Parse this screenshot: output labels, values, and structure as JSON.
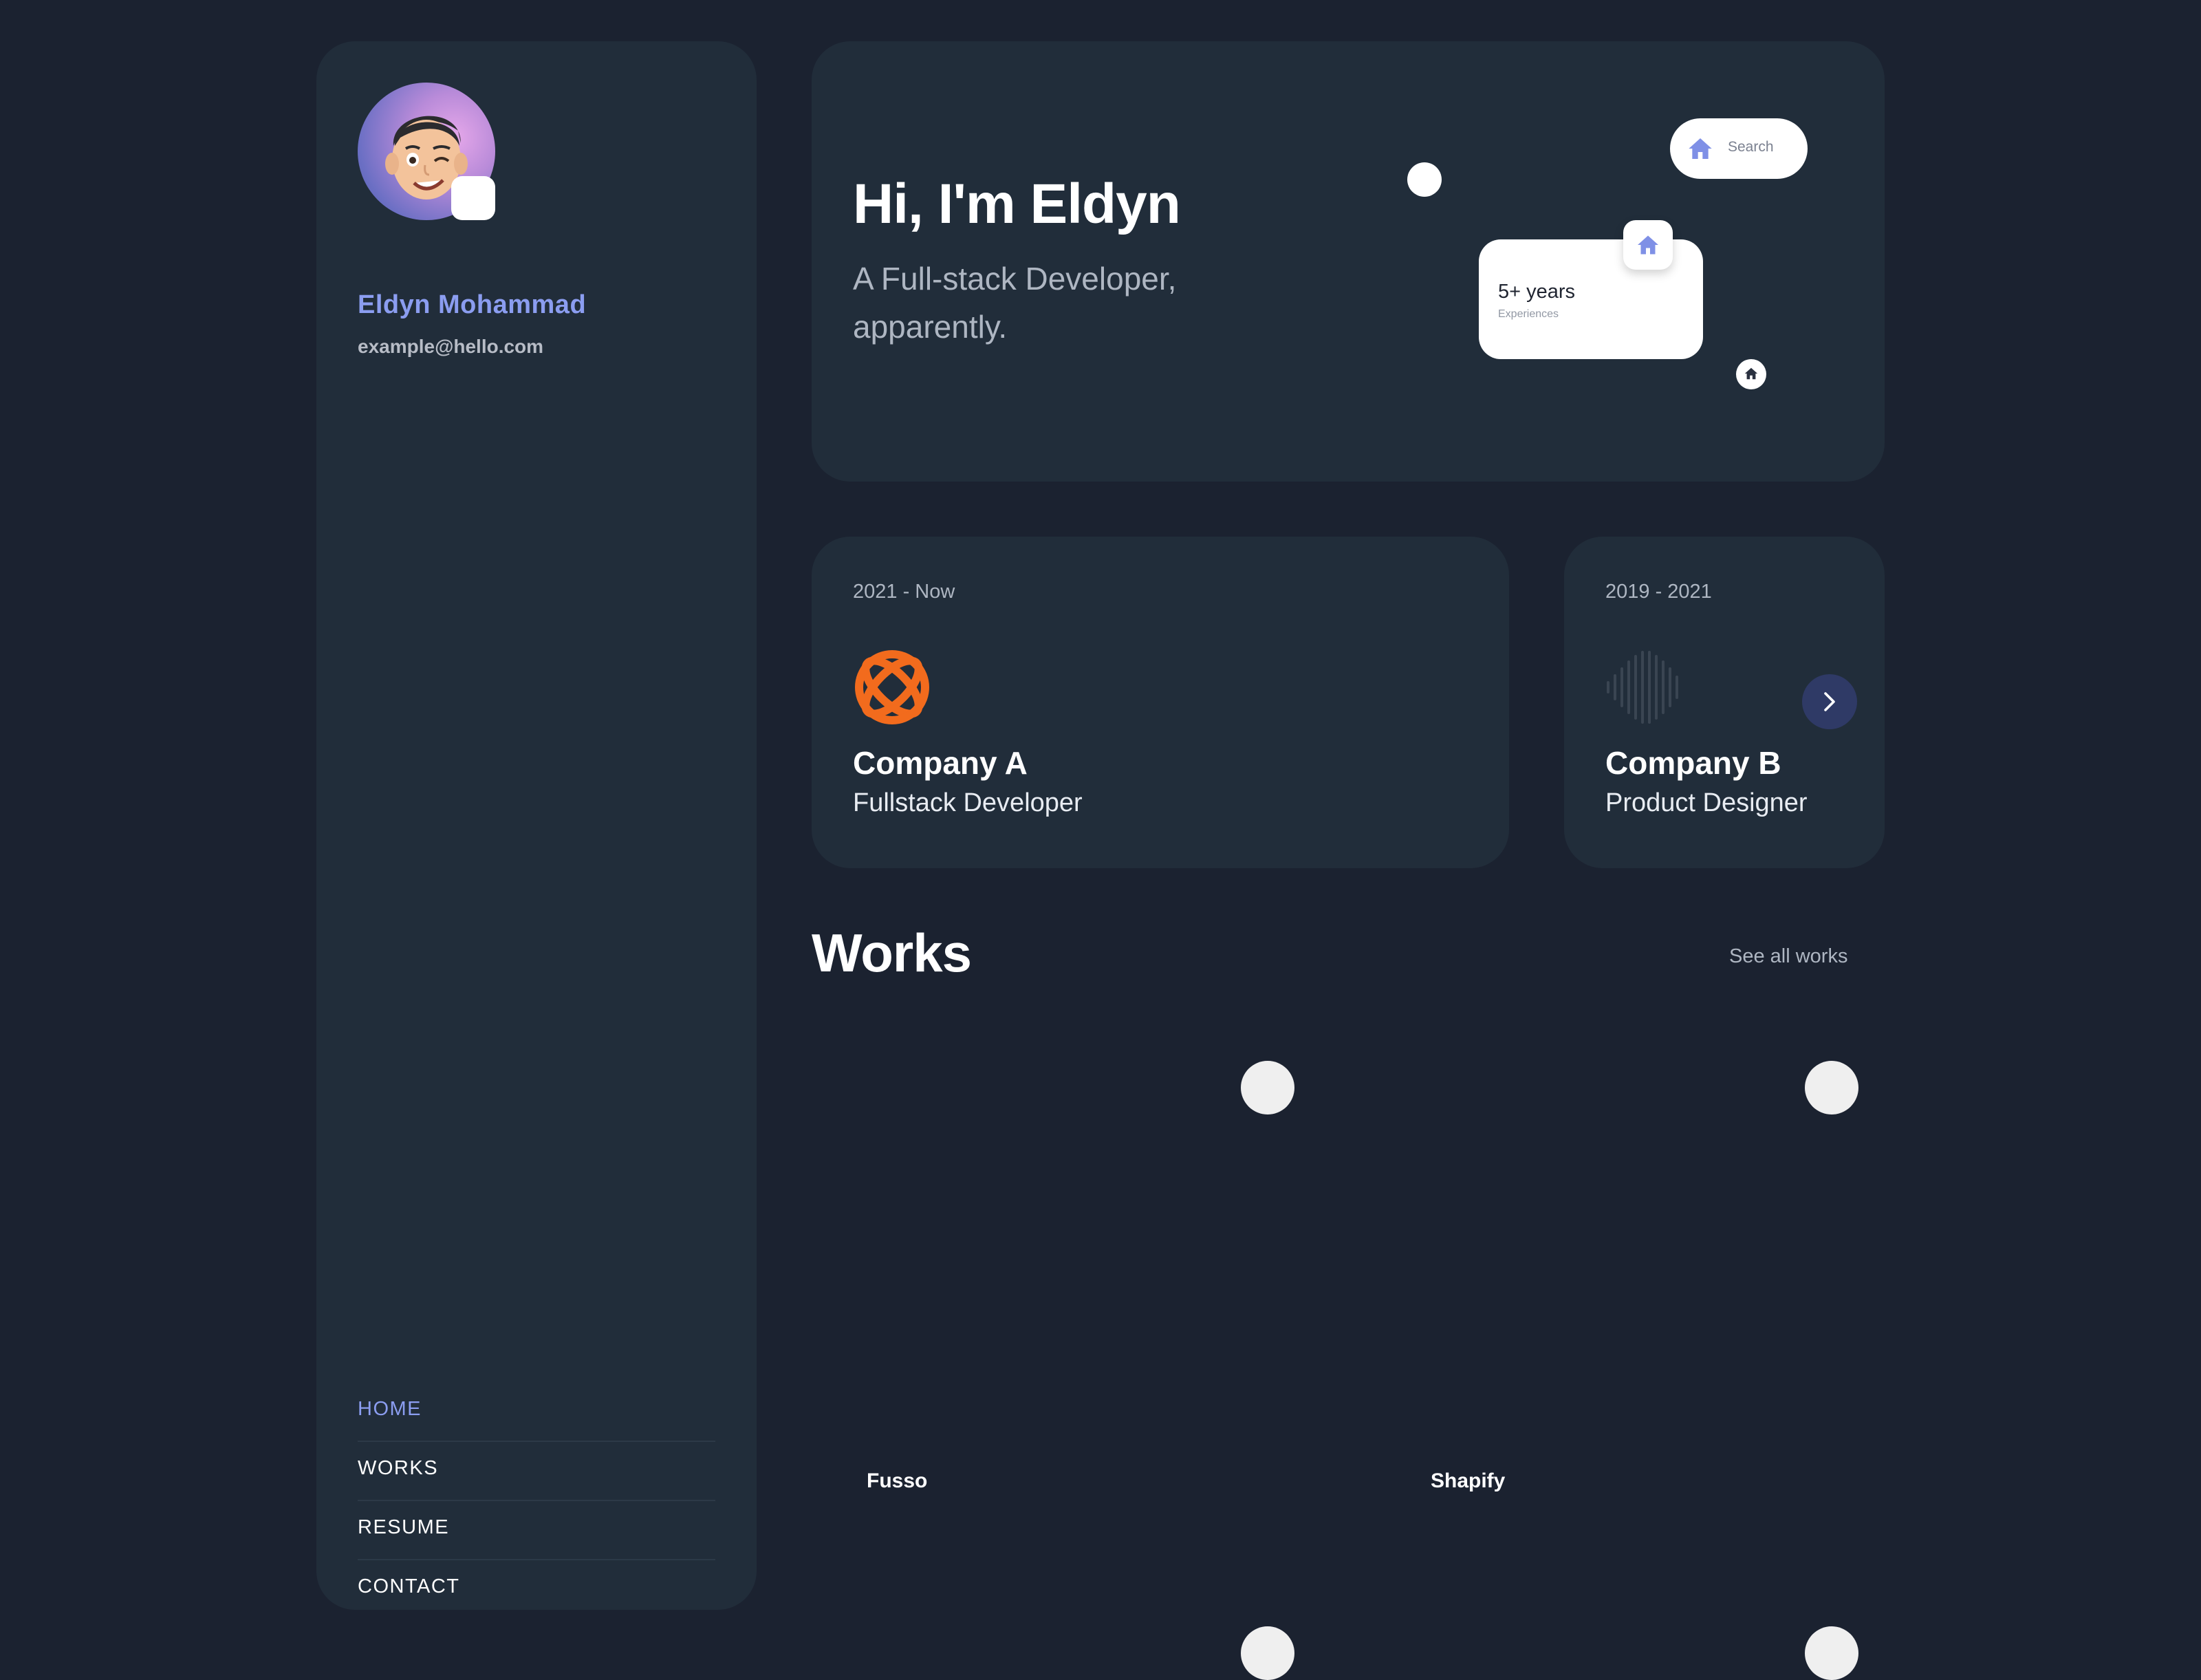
{
  "profile": {
    "name": "Eldyn Mohammad",
    "email": "example@hello.com"
  },
  "nav": {
    "items": [
      {
        "label": "HOME",
        "active": true
      },
      {
        "label": "WORKS",
        "active": false
      },
      {
        "label": "RESUME",
        "active": false
      },
      {
        "label": "CONTACT",
        "active": false
      }
    ]
  },
  "hero": {
    "title": "Hi, I'm Eldyn",
    "subtitle": "A Full-stack Developer, apparently.",
    "search_label": "Search",
    "experience_years": "5+ years",
    "experience_caption": "Experiences"
  },
  "jobs": [
    {
      "period": "2021 - Now",
      "company": "Company A",
      "role": "Fullstack Developer",
      "logo": "orange-lattice-logo"
    },
    {
      "period": "2019 - 2021",
      "company": "Company B",
      "role": "Product Designer",
      "logo": "sound-wave-logo"
    }
  ],
  "works": {
    "title": "Works",
    "see_all": "See all works",
    "items": [
      {
        "label": "Fusso"
      },
      {
        "label": "Shapify"
      }
    ]
  },
  "colors": {
    "background": "#1b2230",
    "card": "#212d3a",
    "accent": "#8b9df0",
    "company_a_logo": "#f26b1d"
  }
}
